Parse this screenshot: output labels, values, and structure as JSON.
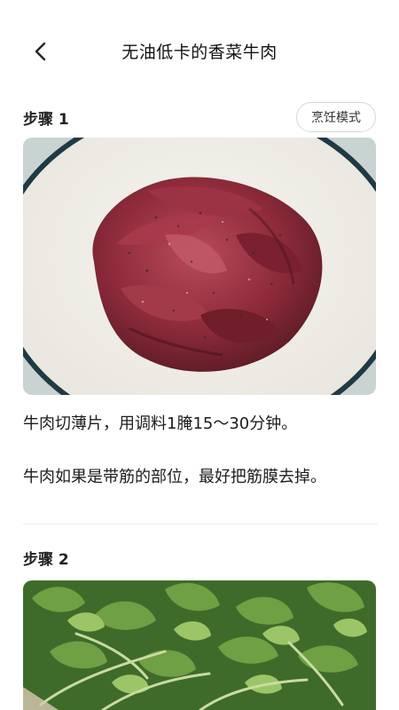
{
  "header": {
    "title": "无油低卡的香菜牛肉",
    "back_icon": "chevron-left-icon"
  },
  "steps": [
    {
      "title": "步骤 1",
      "cook_mode_label": "烹饪模式",
      "image": "sliced marinated raw beef in a white enamel bowl",
      "paragraphs": [
        "牛肉切薄片，用调料1腌15～30分钟。",
        "牛肉如果是带筋的部位，最好把筋膜去掉。"
      ]
    },
    {
      "title": "步骤 2",
      "image": "fresh green cilantro leaves"
    }
  ],
  "colors": {
    "text": "#1a1a1a",
    "divider": "#eeeeee",
    "button_border": "#d7d7d7"
  }
}
